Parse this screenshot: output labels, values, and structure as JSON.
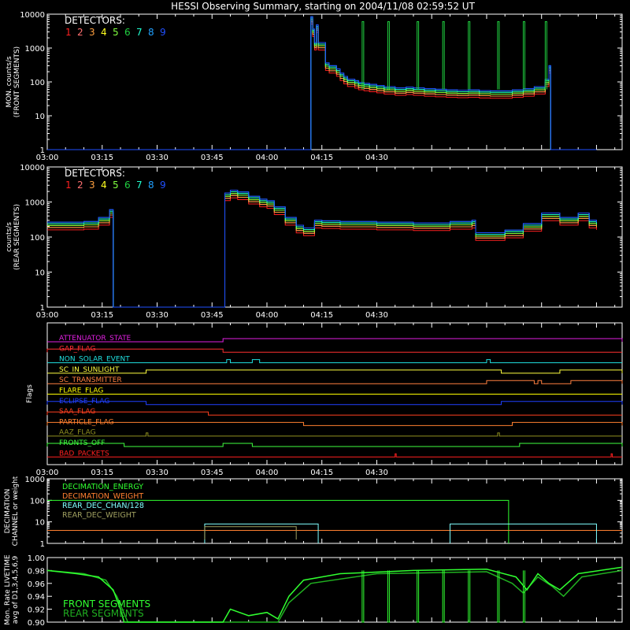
{
  "title": "HESSI Observing Summary, starting on 2004/11/08 02:59:52 UT",
  "colors": {
    "det": [
      "#ff2020",
      "#ff7070",
      "#ffa040",
      "#ffff20",
      "#80ff40",
      "#20d040",
      "#20ffd0",
      "#20a0ff",
      "#2050ff"
    ],
    "axis": "#ffffff",
    "trace": "#1a30ff"
  },
  "time_ticks": [
    "03:00",
    "03:15",
    "03:30",
    "03:45",
    "04:00",
    "04:15",
    "04:30"
  ],
  "chart_data": [
    {
      "type": "line",
      "id": "front",
      "ylabel": "MON. counts/s\n(FRONT SEGMENTS)",
      "yscale": "log",
      "ylim": [
        1,
        10000
      ],
      "yticks": [
        "1",
        "10",
        "100",
        "1000",
        "10000"
      ],
      "legend_title": "DETECTORS:",
      "legend_numbers": [
        "1",
        "2",
        "3",
        "4",
        "5",
        "6",
        "7",
        "8",
        "9"
      ],
      "x_minutes": [
        0,
        72,
        72,
        72.5,
        73,
        73.5,
        74,
        76,
        77,
        79,
        80,
        81,
        82,
        84,
        85,
        86.5,
        88,
        90,
        92,
        95,
        98,
        100,
        103,
        106,
        109,
        112,
        115,
        118,
        121,
        124,
        127,
        130,
        133,
        136,
        137,
        137.5,
        140,
        150
      ],
      "values": [
        1,
        1,
        7000,
        3000,
        1200,
        4000,
        1200,
        300,
        250,
        200,
        150,
        120,
        100,
        90,
        80,
        75,
        70,
        65,
        60,
        55,
        58,
        55,
        52,
        50,
        48,
        47,
        48,
        46,
        45,
        45,
        48,
        52,
        60,
        100,
        250,
        1,
        1,
        1
      ]
    },
    {
      "type": "line",
      "id": "rear",
      "ylabel": "counts/s\n(REAR SEGMENTS)",
      "yscale": "log",
      "ylim": [
        1,
        10000
      ],
      "yticks": [
        "1",
        "10",
        "100",
        "1000",
        "10000"
      ],
      "legend_title": "DETECTORS:",
      "legend_numbers": [
        "1",
        "2",
        "3",
        "4",
        "5",
        "6",
        "7",
        "8",
        "9"
      ],
      "x_minutes": [
        0,
        5,
        10,
        14,
        17,
        18,
        18.5,
        48,
        48.5,
        50,
        52,
        55,
        58,
        60,
        62,
        65,
        68,
        70,
        73,
        75,
        80,
        90,
        100,
        110,
        116,
        117,
        125,
        130,
        135,
        140,
        145,
        148,
        150
      ],
      "values": [
        220,
        220,
        230,
        300,
        500,
        1,
        1,
        1,
        1500,
        1800,
        1600,
        1200,
        1000,
        900,
        600,
        300,
        180,
        150,
        250,
        240,
        230,
        220,
        210,
        230,
        250,
        110,
        130,
        200,
        400,
        300,
        400,
        250,
        220
      ]
    },
    {
      "type": "flags",
      "id": "flags",
      "ylabel": "Flags",
      "rows": [
        {
          "name": "ATTENUATOR_STATE",
          "color": "#e020e0"
        },
        {
          "name": "GAP_FLAG",
          "color": "#ff3030"
        },
        {
          "name": "NON_SOLAR_EVENT",
          "color": "#20e0e0"
        },
        {
          "name": "SC_IN_SUNLIGHT",
          "color": "#ffff40"
        },
        {
          "name": "SC_TRANSMITTER",
          "color": "#ff8040"
        },
        {
          "name": "FLARE_FLAG",
          "color": "#ffff00"
        },
        {
          "name": "ECLIPSE_FLAG",
          "color": "#2040ff"
        },
        {
          "name": "SAA_FLAG",
          "color": "#ff4020"
        },
        {
          "name": "PARTICLE_FLAG",
          "color": "#ff8030"
        },
        {
          "name": "AAZ_FLAG",
          "color": "#909020"
        },
        {
          "name": "FRONTS_OFF",
          "color": "#40ff40"
        },
        {
          "name": "BAD_PACKETS",
          "color": "#ff2020"
        }
      ]
    },
    {
      "type": "line",
      "id": "decimation",
      "ylabel": "DECIMATION\nCHANNEL or weight",
      "yscale": "log",
      "ylim": [
        1,
        1000
      ],
      "yticks": [
        "1",
        "10",
        "100",
        "1000"
      ],
      "series": [
        {
          "name": "DECIMATION_ENERGY",
          "color": "#30ff30"
        },
        {
          "name": "DECIMATION_WEIGHT",
          "color": "#ff8030"
        },
        {
          "name": "REAR_DEC_CHAN/128",
          "color": "#80ffff"
        },
        {
          "name": "REAR_DEC_WEIGHT",
          "color": "#a0a060"
        }
      ]
    },
    {
      "type": "line",
      "id": "livetime",
      "ylabel": "Mon. Rate LIVETIME\navg of D1,3,4,5,6,9",
      "ylim": [
        0.9,
        1.0
      ],
      "yticks": [
        "0.90",
        "0.92",
        "0.94",
        "0.96",
        "0.98",
        "1.00"
      ],
      "series": [
        {
          "name": "FRONT SEGMENTS",
          "color": "#30ff30"
        },
        {
          "name": "REAR SEGMENTS",
          "color": "#20b020"
        }
      ]
    }
  ]
}
